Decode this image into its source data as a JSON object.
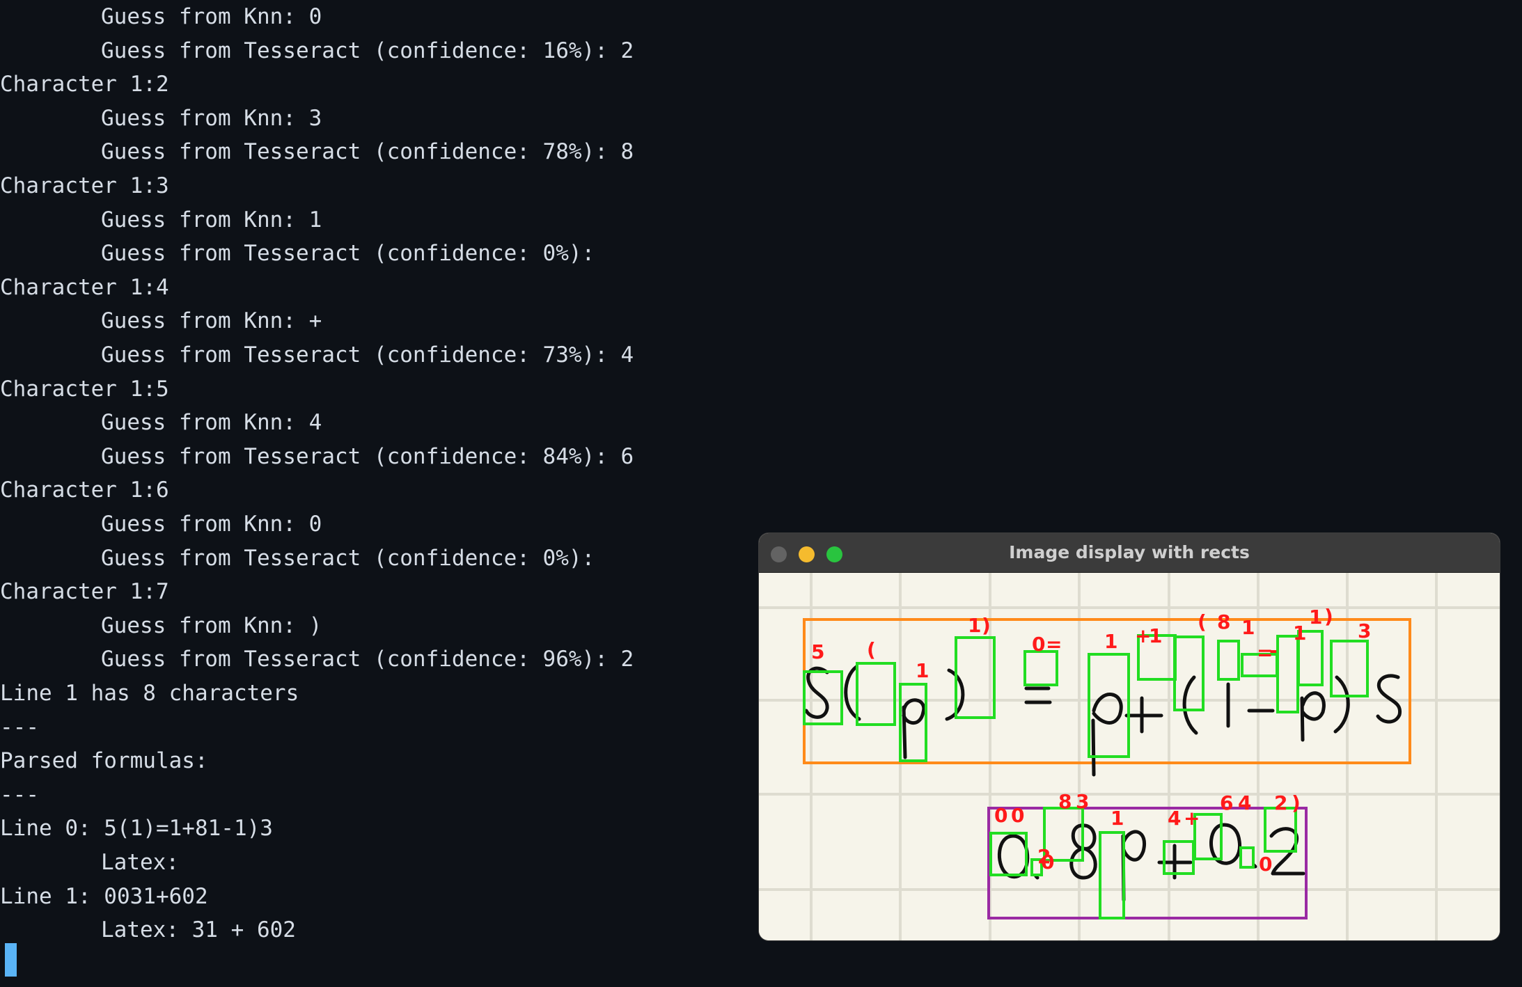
{
  "terminal": {
    "lines": [
      {
        "text": "Guess from Knn: 0",
        "indent": true
      },
      {
        "text": "Guess from Tesseract (confidence: 16%): 2",
        "indent": true
      },
      {
        "text": "Character 1:2",
        "indent": false
      },
      {
        "text": "Guess from Knn: 3",
        "indent": true
      },
      {
        "text": "Guess from Tesseract (confidence: 78%): 8",
        "indent": true
      },
      {
        "text": "Character 1:3",
        "indent": false
      },
      {
        "text": "Guess from Knn: 1",
        "indent": true
      },
      {
        "text": "Guess from Tesseract (confidence: 0%):",
        "indent": true
      },
      {
        "text": "Character 1:4",
        "indent": false
      },
      {
        "text": "Guess from Knn: +",
        "indent": true
      },
      {
        "text": "Guess from Tesseract (confidence: 73%): 4",
        "indent": true
      },
      {
        "text": "Character 1:5",
        "indent": false
      },
      {
        "text": "Guess from Knn: 4",
        "indent": true
      },
      {
        "text": "Guess from Tesseract (confidence: 84%): 6",
        "indent": true
      },
      {
        "text": "Character 1:6",
        "indent": false
      },
      {
        "text": "Guess from Knn: 0",
        "indent": true
      },
      {
        "text": "Guess from Tesseract (confidence: 0%):",
        "indent": true
      },
      {
        "text": "Character 1:7",
        "indent": false
      },
      {
        "text": "Guess from Knn: )",
        "indent": true
      },
      {
        "text": "Guess from Tesseract (confidence: 96%): 2",
        "indent": true
      },
      {
        "text": "Line 1 has 8 characters",
        "indent": false
      },
      {
        "text": "---",
        "indent": false
      },
      {
        "text": "Parsed formulas:",
        "indent": false
      },
      {
        "text": "---",
        "indent": false
      },
      {
        "text": "Line 0: 5(1)=1+81-1)3",
        "indent": false
      },
      {
        "text": "Latex:",
        "indent": true
      },
      {
        "text": "Line 1: 0031+602",
        "indent": false
      },
      {
        "text": "Latex: 31 + 602",
        "indent": true
      }
    ]
  },
  "image_window": {
    "title": "Image display with rects",
    "traffic_lights": [
      "close",
      "minimize",
      "maximize"
    ],
    "colors": {
      "line0_box": "#ff8a1a",
      "line1_box": "#9a2aa3",
      "char_box": "#22dd22",
      "label": "#ff1a1a",
      "ink": "#111111",
      "grid": "#dedcd0",
      "paper": "#f6f4ea"
    },
    "line0": {
      "handwriting": [
        "S",
        "(",
        "p",
        ")",
        "=",
        "p",
        "+",
        "(",
        "1",
        "-",
        "p",
        ")",
        "S"
      ],
      "labels": [
        "5",
        "(",
        "1",
        "1",
        ")",
        "0",
        "=",
        "1",
        "+",
        "1",
        "(",
        "8",
        "1",
        "=",
        "-",
        "1",
        "1",
        ")",
        "3"
      ]
    },
    "line1": {
      "handwriting": [
        "0",
        ".",
        "8",
        "p",
        "+",
        "0",
        ".",
        "2"
      ],
      "labels": [
        "0",
        "0",
        "2",
        "0",
        "8",
        "3",
        "1",
        "4",
        "+",
        "6",
        "4",
        "0",
        "2",
        ")"
      ]
    }
  }
}
